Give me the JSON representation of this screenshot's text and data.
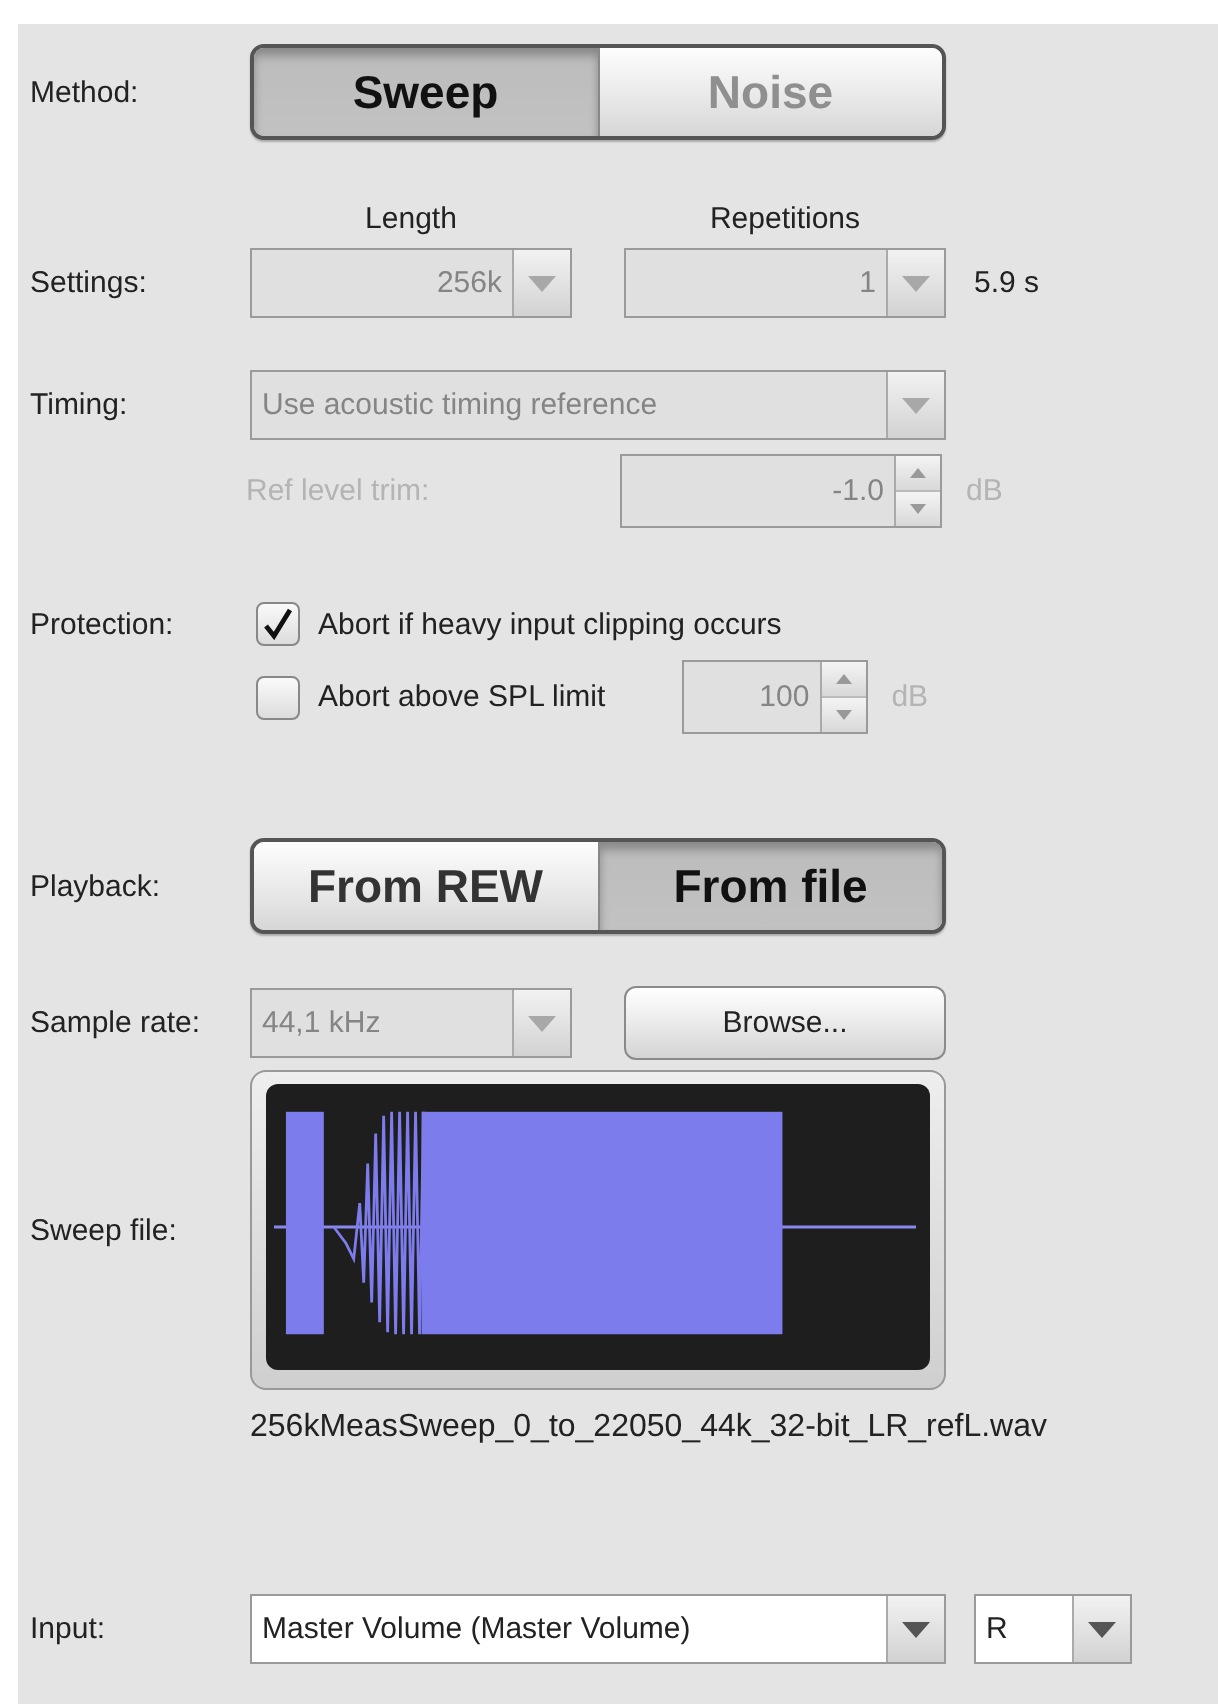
{
  "method": {
    "label": "Method:",
    "options": [
      {
        "label": "Sweep",
        "selected": true,
        "disabled": false
      },
      {
        "label": "Noise",
        "selected": false,
        "disabled": true
      }
    ]
  },
  "settings": {
    "label": "Settings:",
    "length": {
      "header": "Length",
      "value": "256k",
      "disabled": true
    },
    "repetitions": {
      "header": "Repetitions",
      "value": "1",
      "disabled": true
    },
    "duration": "5.9 s"
  },
  "timing": {
    "label": "Timing:",
    "value": "Use acoustic timing reference",
    "disabled": true,
    "ref_level_trim": {
      "label": "Ref level trim:",
      "value": "-1.0",
      "unit": "dB",
      "disabled": true
    }
  },
  "protection": {
    "label": "Protection:",
    "options": [
      {
        "label": "Abort if heavy input clipping occurs",
        "checked": true
      },
      {
        "label": "Abort above SPL limit",
        "checked": false,
        "limit": {
          "value": "100",
          "unit": "dB",
          "disabled": true
        }
      }
    ]
  },
  "playback": {
    "label": "Playback:",
    "options": [
      {
        "label": "From REW",
        "selected": false,
        "disabled": false
      },
      {
        "label": "From file",
        "selected": true,
        "disabled": false
      }
    ]
  },
  "sample_rate": {
    "label": "Sample rate:",
    "value": "44,1 kHz",
    "disabled": true
  },
  "browse_button": "Browse...",
  "sweep_file": {
    "label": "Sweep file:",
    "file_name": "256kMeasSweep_0_to_22050_44k_32-bit_LR_refL.wav"
  },
  "input": {
    "label": "Input:",
    "device": {
      "value": "Master Volume (Master Volume)",
      "disabled": false
    },
    "channel": {
      "value": "R",
      "disabled": false
    }
  }
}
